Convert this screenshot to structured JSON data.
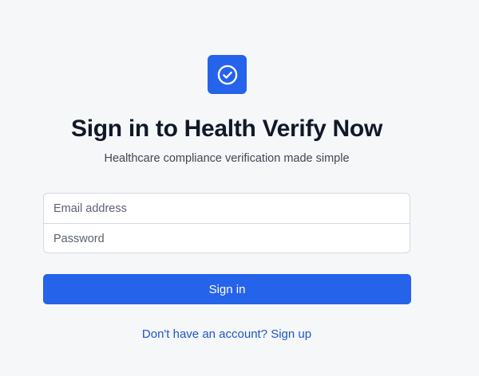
{
  "brand": {
    "accent_color": "#2563eb",
    "logo_icon": "check-circle-icon"
  },
  "header": {
    "title": "Sign in to Health Verify Now",
    "subtitle": "Healthcare compliance verification made simple"
  },
  "form": {
    "email_placeholder": "Email address",
    "email_value": "",
    "password_placeholder": "Password",
    "password_value": "",
    "submit_label": "Sign in"
  },
  "footer": {
    "signup_link_text": "Don't have an account? Sign up"
  }
}
